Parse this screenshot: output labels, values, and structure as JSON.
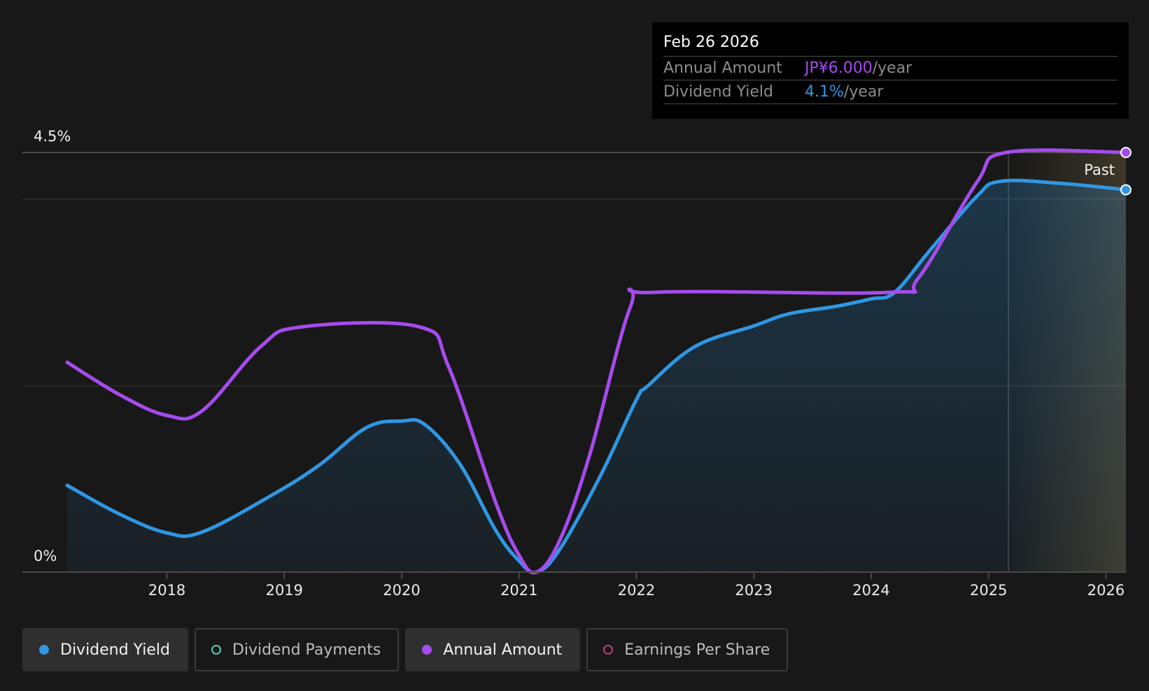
{
  "tooltip": {
    "date": "Feb 26 2026",
    "rows": [
      {
        "label": "Annual Amount",
        "value": "JP¥6.000",
        "suffix": "/year",
        "color": "#a64bee"
      },
      {
        "label": "Dividend Yield",
        "value": "4.1%",
        "suffix": "/year",
        "color": "#2f97e3"
      }
    ]
  },
  "past_label": "Past",
  "legend": [
    {
      "label": "Dividend Yield",
      "color": "#2f97e3",
      "style": "filled",
      "active": true
    },
    {
      "label": "Dividend Payments",
      "color": "#5fc9b4",
      "style": "outline",
      "active": false
    },
    {
      "label": "Annual Amount",
      "color": "#a64bee",
      "style": "filled",
      "active": true
    },
    {
      "label": "Earnings Per Share",
      "color": "#c0407c",
      "style": "outline",
      "active": false
    }
  ],
  "chart_data": {
    "type": "line",
    "title": "",
    "xlabel": "",
    "ylabel": "",
    "xlim": [
      2017.15,
      2026.17
    ],
    "ylim": [
      0,
      4.5
    ],
    "y_ticks": [
      "0%",
      "4.5%"
    ],
    "x_ticks": [
      2018,
      2019,
      2020,
      2021,
      2022,
      2023,
      2024,
      2025,
      2026
    ],
    "past_region_start": 2025.17,
    "grid": true,
    "series": [
      {
        "name": "Dividend Yield",
        "color": "#2f97e3",
        "area": true,
        "x": [
          2017.15,
          2017.6,
          2018.0,
          2018.3,
          2018.9,
          2019.3,
          2019.7,
          2020.0,
          2020.2,
          2020.5,
          2020.8,
          2021.0,
          2021.15,
          2021.35,
          2021.7,
          2022.0,
          2022.1,
          2022.5,
          2023.0,
          2023.3,
          2023.7,
          2024.0,
          2024.2,
          2024.5,
          2024.9,
          2025.1,
          2025.6,
          2026.17
        ],
        "values": [
          0.93,
          0.62,
          0.42,
          0.43,
          0.83,
          1.15,
          1.55,
          1.62,
          1.58,
          1.15,
          0.45,
          0.12,
          0.0,
          0.25,
          1.05,
          1.85,
          2.0,
          2.42,
          2.64,
          2.77,
          2.85,
          2.93,
          3.0,
          3.45,
          4.03,
          4.19,
          4.17,
          4.1
        ]
      },
      {
        "name": "Annual Amount",
        "color": "#a64bee",
        "area": false,
        "x": [
          2017.15,
          2017.6,
          2018.0,
          2018.3,
          2018.8,
          2019.15,
          2020.15,
          2020.4,
          2020.8,
          2021.0,
          2021.15,
          2021.35,
          2021.6,
          2021.95,
          2022.15,
          2024.15,
          2024.4,
          2024.9,
          2025.15,
          2026.17
        ],
        "values": [
          2.25,
          1.9,
          1.68,
          1.73,
          2.42,
          2.63,
          2.63,
          2.2,
          0.75,
          0.18,
          0.0,
          0.35,
          1.25,
          2.85,
          3.0,
          3.0,
          3.15,
          4.18,
          4.5,
          4.5
        ]
      }
    ]
  }
}
